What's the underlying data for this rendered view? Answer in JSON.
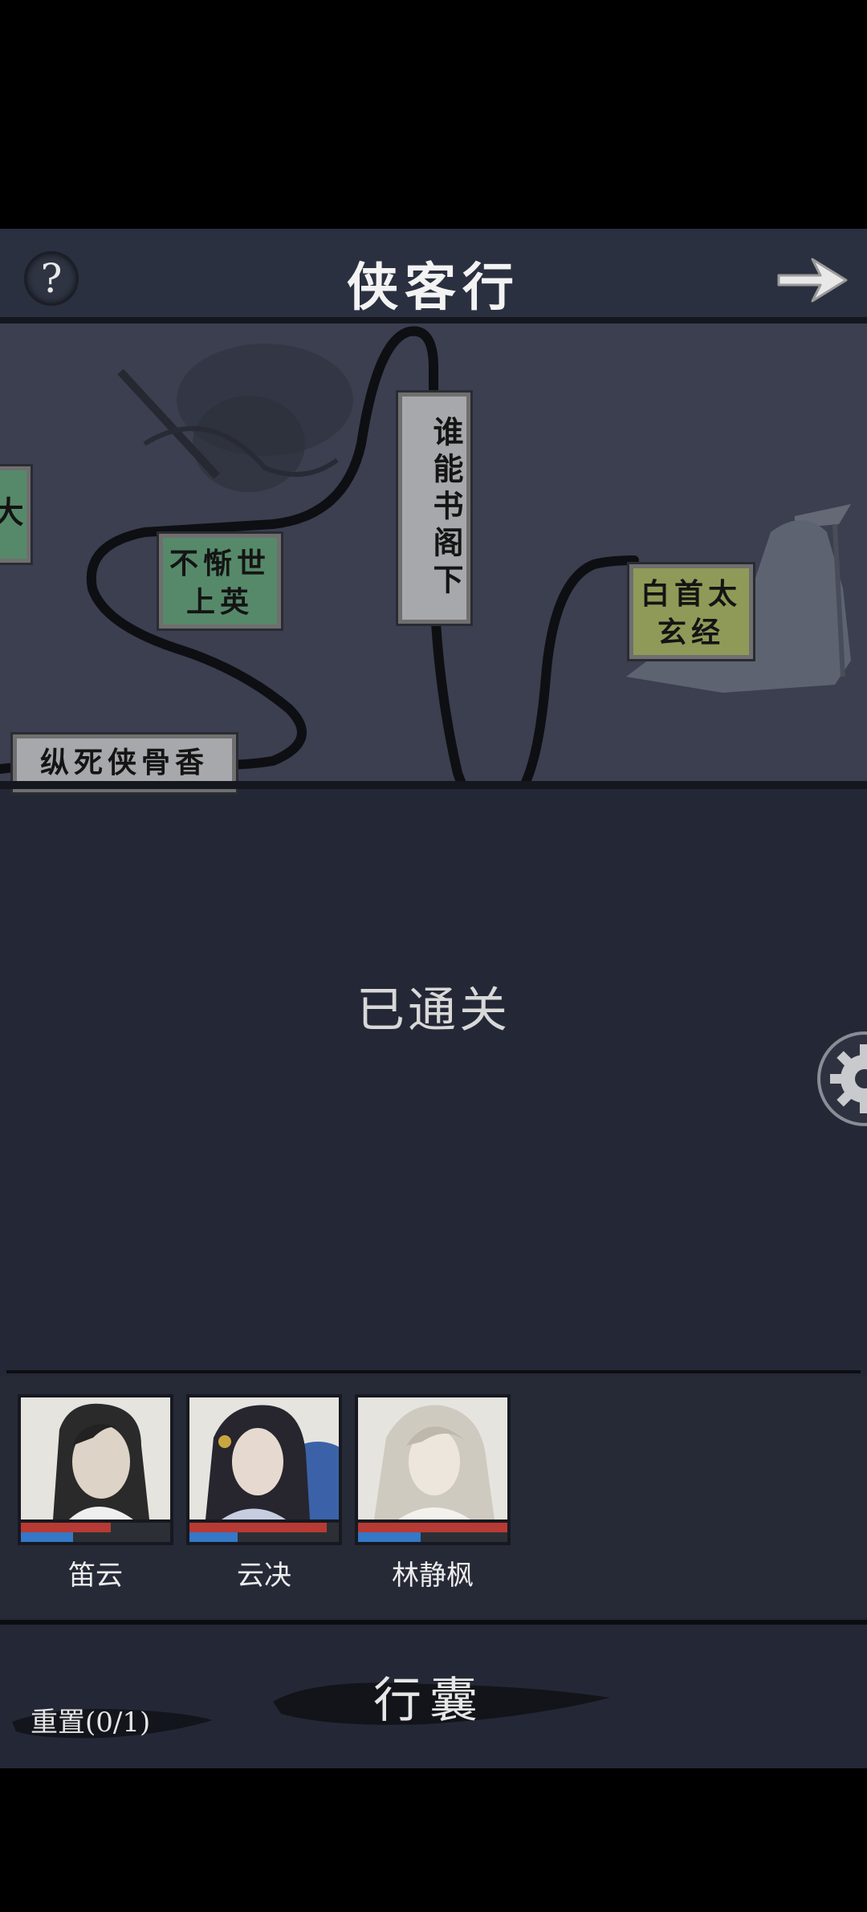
{
  "header": {
    "title": "侠客行",
    "help_label": "?"
  },
  "map": {
    "nodes": {
      "partial": "大",
      "zongsi": "纵死侠骨香",
      "buchan": "不惭世上英",
      "shuineng": "谁能书阁下",
      "baishou": "白首太玄经"
    }
  },
  "status_text": "已通关",
  "party": [
    {
      "name": "笛云",
      "hp": 0.6,
      "mp": 0.35
    },
    {
      "name": "云决",
      "hp": 0.92,
      "mp": 0.32
    },
    {
      "name": "林静枫",
      "hp": 1.0,
      "mp": 0.42
    }
  ],
  "footer": {
    "bag_label": "行囊",
    "reset_label": "重置(0/1)"
  },
  "colors": {
    "bg": "#242836",
    "node_green": "#56896a",
    "node_gray": "#a7a8ab",
    "node_olive": "#8f9a58",
    "hp": "#b73a34",
    "mp": "#3478c7"
  }
}
